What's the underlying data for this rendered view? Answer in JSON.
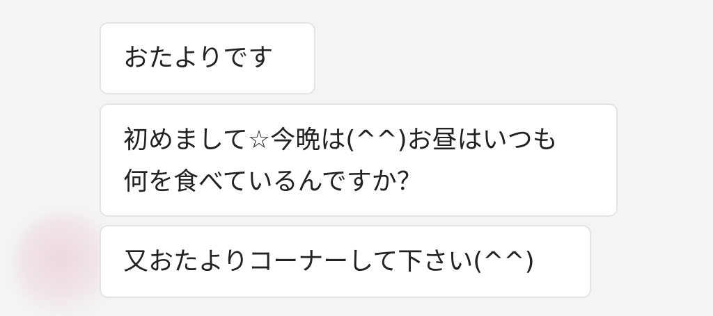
{
  "messages": [
    {
      "lines": [
        "おたよりです"
      ]
    },
    {
      "lines": [
        "初めまして☆今晩は(^^)お昼はいつも",
        "何を食べているんですか？"
      ]
    },
    {
      "lines": [
        "又おたよりコーナーして下さい(^^)"
      ]
    }
  ],
  "colors": {
    "background": "#f4f4f5",
    "bubble": "#ffffff",
    "bubble_border": "#e4e4e6",
    "text": "#222222"
  }
}
